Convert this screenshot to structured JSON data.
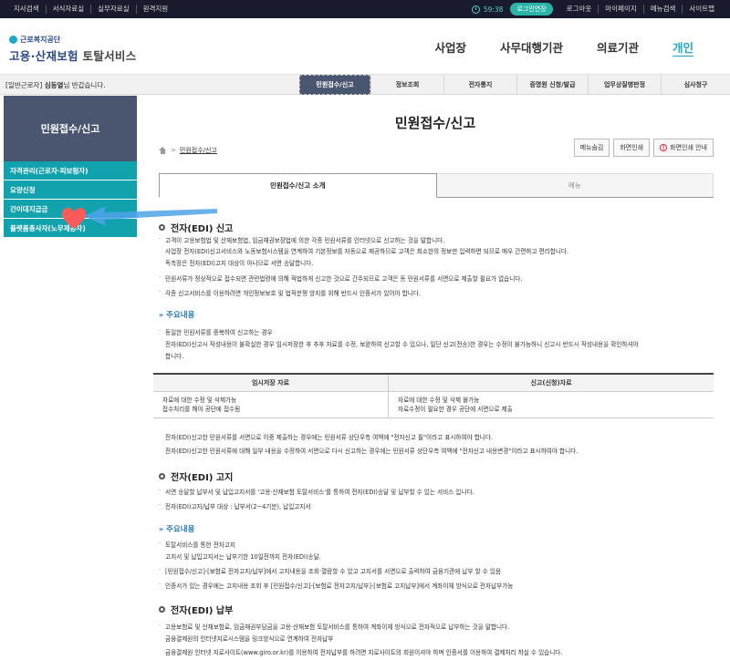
{
  "topbar": {
    "left_links": [
      "지사검색",
      "서식자료실",
      "실무자료실",
      "원격지원"
    ],
    "timer": "59:38",
    "extend_label": "로그인연장",
    "right_links": [
      "로그아웃",
      "마이페이지",
      "메뉴검색",
      "사이트맵"
    ]
  },
  "header": {
    "logo_small": "근로복지공단",
    "logo_main": "고용·산재보험",
    "logo_service": "토탈서비스",
    "nav": [
      "사업장",
      "사무대행기관",
      "의료기관",
      "개인"
    ]
  },
  "subbar": {
    "welcome_prefix": "[일반근로자]",
    "user_name": "심동열",
    "welcome_suffix": "님 반갑습니다.",
    "menu": [
      "민원접수/신고",
      "정보조회",
      "전자통지",
      "증명원 신청/발급",
      "업무상질병판정",
      "심사청구"
    ]
  },
  "sidebar": {
    "title": "민원접수/신고",
    "items": [
      "자격관리(근로자·피보험자)",
      "요양신청",
      "간이대지급금",
      "플랫폼종사자(노무제공자)"
    ]
  },
  "content": {
    "title": "민원접수/신고",
    "breadcrumb": "민원접수/신고",
    "tools": [
      "메뉴숨김",
      "화면인쇄",
      "화면인쇄 안내"
    ],
    "tabs": [
      "민원접수/신고 소개",
      "메뉴"
    ],
    "sec1": {
      "heading": "전자(EDI) 신고",
      "lines": [
        "고객이 고용보험법 및 산재보험법, 임금채권보장법에 의한 각종 민원서류를 인터넷으로 신고하는 것을 말합니다.",
        "사업장 전자(EDI)신고서비스와 노동보험시스템을 연계하여 기본정보를 자동으로 제공하므로 고객은 최소한의 정보만 입력하면 되므로 매우 간편하고 편리합니다.",
        "독촉장은 전자(EDI)고지 대상이 아니므로 서면 송달합니다.",
        "민원서류가 정상적으로 접수되면 관련법령에 의해 적법하게 신고한 것으로 간주되므로 고객은 동 민원서류를 서면으로 제출할 필요가 없습니다.",
        "각종 신고서비스를 이용하려면 개인정보보호 및 법적분쟁 방지를 위해 반드시 인증서가 있어야 합니다."
      ],
      "sub_heading": "주요내용",
      "sub_lines": [
        "동일한 민원서류를 중복하여 신고하는 경우",
        "전자(EDI)신고시 작성내용이 불확실한 경우 임시저장한 후 추후 자료를 수정, 보완하여 신고할 수 있으나, 일단 신고(전송)한 경우는 수정이 불가능하니 신고시 반드시 작성내용을 확인하셔야",
        "합니다."
      ],
      "table": {
        "headers": [
          "임시저장 자료",
          "신고(신청)자료"
        ],
        "col1": [
          "자료에 대한 수정 및 삭제가능",
          "접수처리를 해야 공단에 접수됨"
        ],
        "col2": [
          "자료에 대한 수정 및 삭제 불가능",
          "자료수정이 필요한 경우 공단에 서면으로 제출"
        ]
      },
      "after_lines": [
        "전자(EDI)신고한 민원서류를 서면으로 이중 제출하는 경우에는 민원서류 상단우측 여백에 \"전자신고 필\"이라고 표시하여야 합니다.",
        "전자(EDI)신고한 민원서류에 대해 일부 내용을 수정하여 서면으로 다시 신고하는 경우에는 민원서류 상단우측 여백에 \"전자신고 내용변경\"이라고 표시하여야 합니다."
      ]
    },
    "sec2": {
      "heading": "전자(EDI) 고지",
      "lines": [
        "서면 송달할 납부서 및 납입고지서를 '고용·산재보험 토탈서비스'를 통하여 전자(EDI)송달 및 납부할 수 있는 서비스 입니다.",
        "전자(EDI)고지/납부 대상 : 납부서(2~4기분), 납입고지서"
      ],
      "sub_heading": "주요내용",
      "sub_lines": [
        "토탈서비스를 통한 전자고지",
        "고지서 및 납입고지서는 납부기한 10일전까지 전자(EDI)송달.",
        "[민원접수/신고]-[보험료 전자고지/납부]에서 고지내용을 조회·열람할 수 있고 고지서를 서면으로 출력하여 금융기관에 납부 할 수 있음",
        "인증서가 있는 경우에는 고지내용 조회 후 [민원접수/신고]-[보험료 전자고지/납부]-[보험료 고지납부]에서 계좌이체 방식으로 전자납부가능"
      ]
    },
    "sec3": {
      "heading": "전자(EDI) 납부",
      "lines": [
        "고용보험료 및 산재보험료, 임금채권부담금을 고용·산재보험 토탈서비스를 통하여 계좌이체 방식으로 전자적으로 납부하는 것을 말합니다.",
        "금융결제원의 인터넷지로시스템을 링크방식으로 연계하여 전자납부",
        "금융결제원 인터넷 지로사이트(www.giro.or.kr)를 이용하여 전자납부를 하려면 지로사이트의 회원이셔야 하며 인증서를 이용하여 결제처리 하실 수 있습니다."
      ]
    }
  },
  "colors": {
    "accent": "#12a2ae",
    "dark": "#4a5670",
    "annotation_arrow": "#4fa3e8",
    "heart": "#ff5a5a"
  }
}
